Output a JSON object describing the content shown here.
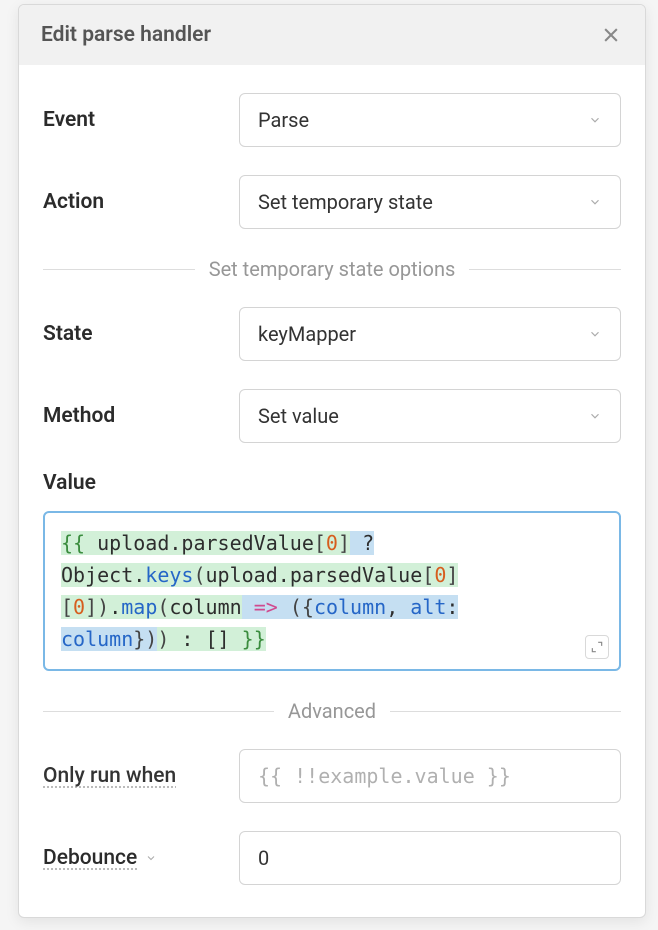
{
  "modal": {
    "title": "Edit parse handler"
  },
  "fields": {
    "event": {
      "label": "Event",
      "value": "Parse"
    },
    "action": {
      "label": "Action",
      "value": "Set temporary state"
    },
    "state": {
      "label": "State",
      "value": "keyMapper"
    },
    "method": {
      "label": "Method",
      "value": "Set value"
    },
    "value": {
      "label": "Value"
    },
    "onlyRun": {
      "label": "Only run when",
      "placeholder": "{{ !!example.value }}",
      "value": ""
    },
    "debounce": {
      "label": "Debounce",
      "value": "0"
    }
  },
  "dividers": {
    "stateOptions": "Set temporary state options",
    "advanced": "Advanced"
  },
  "code": {
    "open1": "{{ ",
    "t1": "upload",
    "dot": ".",
    "t2": "parsedValue",
    "lb": "[",
    "n0": "0",
    "rb": "]",
    "sp": " ",
    "q": "?",
    "t3": "Object",
    "t4": "keys",
    "lp": "(",
    "rp": ")",
    "t5": "map",
    "t6": "column",
    "arrow": "=>",
    "lpc": "(",
    "lcb": "{",
    "comma": ",",
    "t7": "alt",
    "colon": ":",
    "rcb": "}",
    "rpc": ")",
    "tcol": " : ",
    "empty": "[]",
    "close": " }}"
  }
}
